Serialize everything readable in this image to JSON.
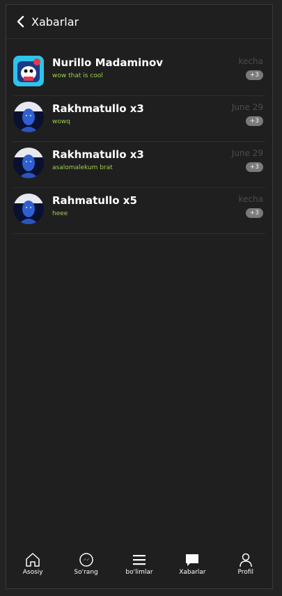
{
  "header": {
    "title": "Xabarlar"
  },
  "conversations": [
    {
      "name": "Nurillo Madaminov",
      "message": "wow that is cool",
      "time": "kecha",
      "badge": "+3"
    },
    {
      "name": "Rakhmatullo x3",
      "message": "wowq",
      "time": "June 29",
      "badge": "+3"
    },
    {
      "name": "Rakhmatullo x3",
      "message": "asalomalekum brat",
      "time": "June 29",
      "badge": "+3"
    },
    {
      "name": "Rahmatullo x5",
      "message": "heee",
      "time": "kecha",
      "badge": "+3"
    }
  ],
  "nav": [
    {
      "label": "Asosiy",
      "icon": "home-icon"
    },
    {
      "label": "So'rang",
      "icon": "messenger-icon"
    },
    {
      "label": "bo'limlar",
      "icon": "menu-icon"
    },
    {
      "label": "Xabarlar",
      "icon": "chat-icon"
    },
    {
      "label": "Profil",
      "icon": "user-icon"
    }
  ],
  "colors": {
    "background": "#1f1f1f",
    "message_green": "#9ed04c",
    "badge_grey": "#7a7a7a",
    "time_grey": "#4c4c4c"
  }
}
